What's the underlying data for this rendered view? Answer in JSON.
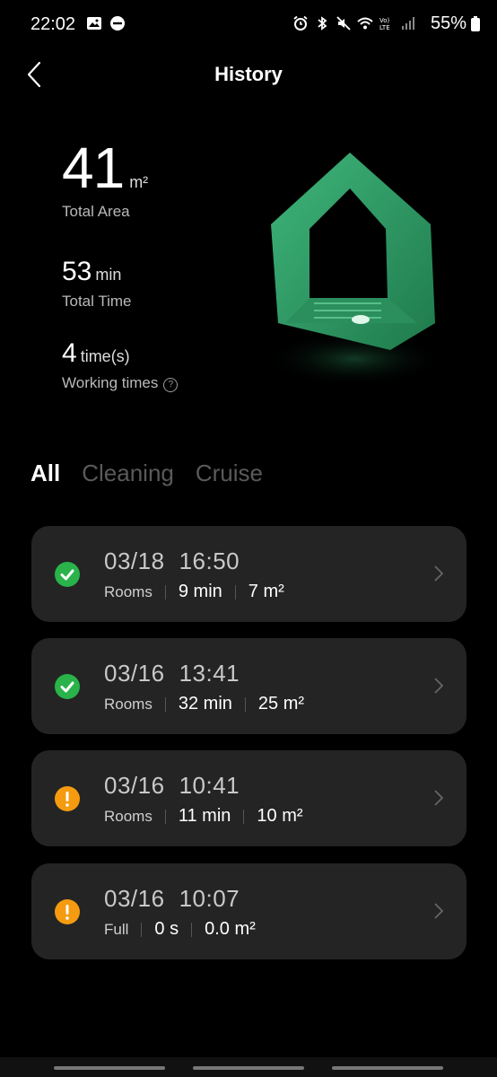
{
  "status_bar": {
    "time": "22:02",
    "battery": "55%"
  },
  "header": {
    "title": "History"
  },
  "stats": {
    "area_value": "41",
    "area_unit": "m²",
    "area_label": "Total Area",
    "time_value": "53",
    "time_unit": "min",
    "time_label": "Total Time",
    "count_value": "4",
    "count_unit": "time(s)",
    "count_label": "Working times"
  },
  "tabs": [
    {
      "label": "All"
    },
    {
      "label": "Cleaning"
    },
    {
      "label": "Cruise"
    }
  ],
  "records": [
    {
      "date": "03/18",
      "time": "16:50",
      "mode": "Rooms",
      "duration": "9 min",
      "area": "7 m²",
      "status": "ok"
    },
    {
      "date": "03/16",
      "time": "13:41",
      "mode": "Rooms",
      "duration": "32 min",
      "area": "25 m²",
      "status": "ok"
    },
    {
      "date": "03/16",
      "time": "10:41",
      "mode": "Rooms",
      "duration": "11 min",
      "area": "10 m²",
      "status": "warn"
    },
    {
      "date": "03/16",
      "time": "10:07",
      "mode": "Full",
      "duration": "0 s",
      "area": "0.0 m²",
      "status": "warn"
    }
  ],
  "colors": {
    "background": "#000000",
    "card": "#242424",
    "success": "#29b34a",
    "warning": "#f59b10",
    "house": "#2e9e67"
  }
}
